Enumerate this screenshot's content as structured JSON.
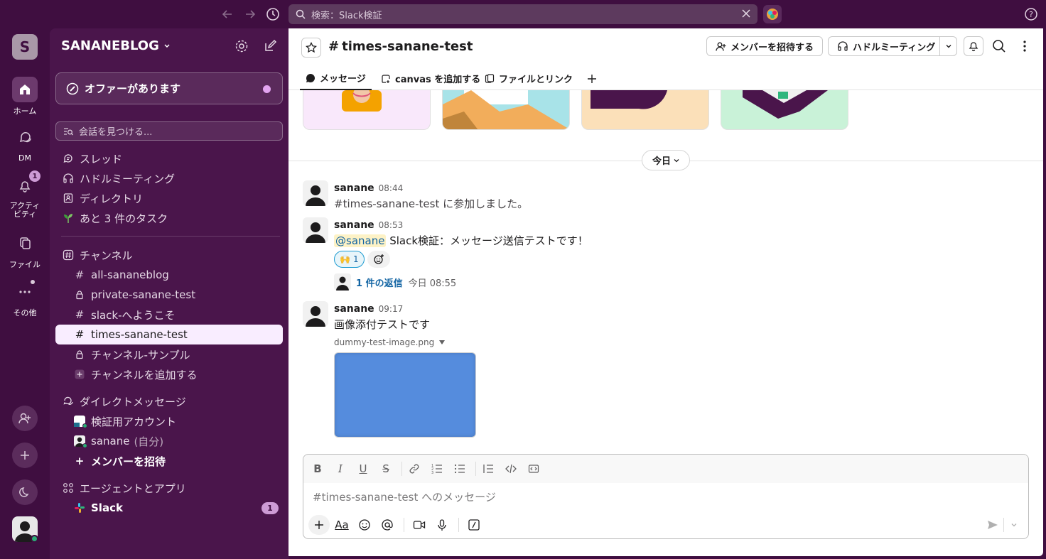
{
  "topbar": {
    "search_placeholder": "検索：Slack検証",
    "icons": [
      "back-arrow-icon",
      "forward-arrow-icon",
      "history-icon",
      "close-icon",
      "help-icon"
    ]
  },
  "rail": {
    "workspace_initial": "S",
    "items": [
      {
        "label": "ホーム"
      },
      {
        "label": "DM"
      },
      {
        "label": "アクティビティ",
        "label_line1": "アクティ",
        "label_line2": "ビティ",
        "badge": "1"
      },
      {
        "label": "ファイル"
      },
      {
        "label": "その他"
      }
    ]
  },
  "sidebar": {
    "workspace_name": "SANANEBLOG",
    "offer": "オファーがあります",
    "find_placeholder": "会話を見つける...",
    "nav": [
      {
        "label": "スレッド",
        "icon": "thread-icon"
      },
      {
        "label": "ハドルミーティング",
        "icon": "headphones-icon"
      },
      {
        "label": "ディレクトリ",
        "icon": "directory-icon"
      },
      {
        "label": "あと 3 件のタスク",
        "icon": "sprout-icon"
      }
    ],
    "channels_header": "チャンネル",
    "channels": [
      {
        "name": "all-sananeblog",
        "icon": "hash-icon"
      },
      {
        "name": "private-sanane-test",
        "icon": "lock-icon"
      },
      {
        "name": "slack-へようこそ",
        "icon": "hash-icon"
      },
      {
        "name": "times-sanane-test",
        "icon": "hash-icon",
        "active": true
      },
      {
        "name": "チャンネル-サンプル",
        "icon": "lock-icon"
      }
    ],
    "add_channel": "チャンネルを追加する",
    "dm_header": "ダイレクトメッセージ",
    "dms": [
      {
        "name": "検証用アカウント"
      },
      {
        "name": "sanane",
        "suffix": "(自分)"
      }
    ],
    "invite_members": "メンバーを招待",
    "apps_header": "エージェントとアプリ",
    "apps": [
      {
        "name": "Slack",
        "badge": "1"
      }
    ]
  },
  "header": {
    "channel_name": "times-sanane-test",
    "invite_button": "メンバーを招待する",
    "huddle_button": "ハドルミーティング",
    "tabs": [
      {
        "label": "メッセージ",
        "active": true
      },
      {
        "label": "canvas を追加する"
      },
      {
        "label": "ファイルとリンク"
      }
    ]
  },
  "feed": {
    "date_divider": "今日",
    "messages": [
      {
        "author": "sanane",
        "time": "08:44",
        "text": "#times-sanane-test に参加しました。"
      },
      {
        "author": "sanane",
        "time": "08:53",
        "mention": "@sanane",
        "text": " Slack検証：メッセージ送信テストです！",
        "reaction": {
          "emoji": "🙌",
          "count": "1"
        },
        "thread": {
          "replies": "1 件の返信",
          "time": "今日 08:55"
        }
      },
      {
        "author": "sanane",
        "time": "09:17",
        "text": "画像添付テストです",
        "attachment": {
          "filename": "dummy-test-image.png",
          "color": "#558cdd"
        }
      }
    ]
  },
  "composer": {
    "placeholder": "#times-sanane-test へのメッセージ"
  },
  "colors": {
    "aubergine": "#3f0e40",
    "sidebar": "#4a154b",
    "active_channel": "#f9edff",
    "link": "#1264a3",
    "image_fill": "#558cdd"
  }
}
